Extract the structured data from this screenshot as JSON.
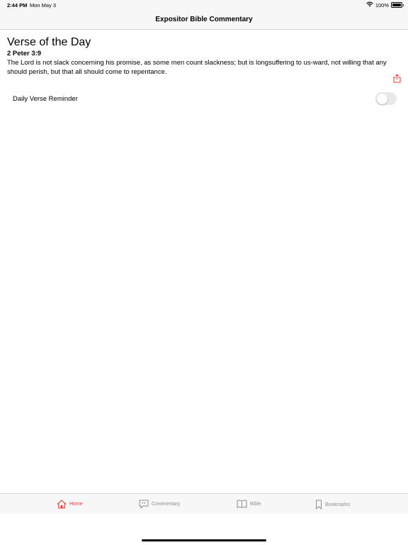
{
  "status_bar": {
    "time": "2:44 PM",
    "date": "Mon May 3",
    "battery": "100%"
  },
  "nav": {
    "title": "Expositor Bible Commentary"
  },
  "verse_of_day": {
    "heading": "Verse of the Day",
    "reference": "2 Peter 3:9",
    "text": "The Lord is not slack concerning his promise, as some men count slackness; but is longsuffering to us-ward, not willing that any should perish, but that all should come to repentance."
  },
  "reminder": {
    "label": "Daily Verse Reminder",
    "enabled": false
  },
  "tabs": [
    {
      "label": "Home",
      "icon": "house-icon",
      "active": true
    },
    {
      "label": "Commentary",
      "icon": "quote-bubble-icon",
      "active": false
    },
    {
      "label": "Bible",
      "icon": "open-book-icon",
      "active": false
    },
    {
      "label": "Bookmarks",
      "icon": "bookmark-icon",
      "active": false
    }
  ],
  "colors": {
    "accent": "#e8392b",
    "inactive_tab": "#8e8e93"
  }
}
